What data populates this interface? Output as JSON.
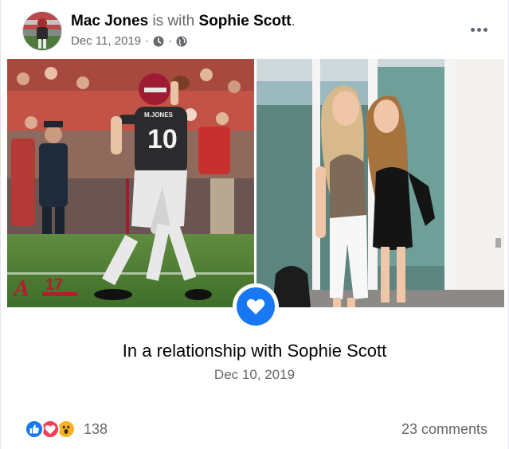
{
  "post": {
    "author": "Mac Jones",
    "with_text": "is with",
    "tagged": "Sophie Scott",
    "period": ".",
    "date": "Dec 11, 2019",
    "separator": "·",
    "icons": [
      "clock-icon",
      "globe-icon"
    ]
  },
  "event": {
    "title": "In a relationship with Sophie Scott",
    "date": "Dec 10, 2019",
    "icon": "heart-icon"
  },
  "footer": {
    "reaction_icons": [
      "like-icon",
      "love-icon",
      "wow-icon"
    ],
    "reaction_count": "138",
    "comments": "23 comments"
  },
  "photo_left": {
    "jersey_name": "M.JONES",
    "jersey_number": "10",
    "logo_letter": "A",
    "logo_number": "17"
  },
  "colors": {
    "accent": "#1877f2",
    "love": "#f33e58",
    "wow": "#f7b125",
    "muted": "#65676b",
    "crimson": "#9e1b32"
  }
}
